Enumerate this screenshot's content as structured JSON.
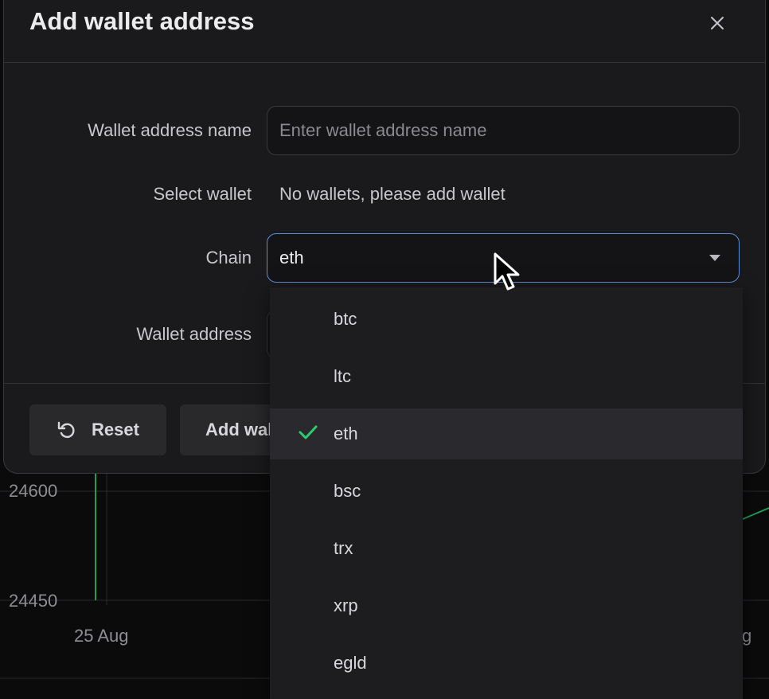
{
  "modal": {
    "title": "Add wallet address",
    "fields": {
      "name_label": "Wallet address name",
      "name_placeholder": "Enter wallet address name",
      "select_wallet_label": "Select wallet",
      "select_wallet_value": "No wallets, please add wallet",
      "chain_label": "Chain",
      "chain_value": "eth",
      "address_label": "Wallet address"
    },
    "buttons": {
      "reset": "Reset",
      "add_partial": "Add wal"
    }
  },
  "dropdown": {
    "options": [
      "btc",
      "ltc",
      "eth",
      "bsc",
      "trx",
      "xrp",
      "egld"
    ],
    "selected": "eth"
  },
  "background_chart": {
    "y_ticks": [
      "24600",
      "24450"
    ],
    "x_ticks": [
      "25 Aug",
      "g"
    ]
  },
  "colors": {
    "accent_border": "#5b8fd8",
    "check": "#2ecc71",
    "chart_line": "#1f9d55"
  }
}
